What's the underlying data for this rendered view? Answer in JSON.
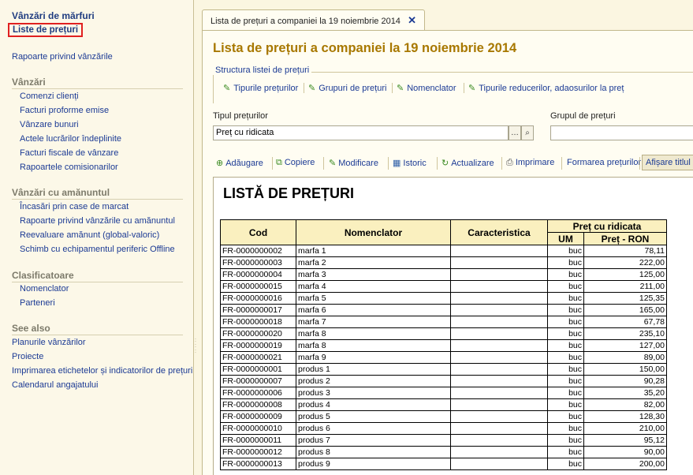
{
  "sidebar": {
    "header_top": "Vânzări de mărfuri",
    "active_item": "Liste de prețuri",
    "sales_reports": "Rapoarte privind vânzările",
    "sections": [
      {
        "title": "Vânzări",
        "items": [
          "Comenzi clienți",
          "Facturi proforme emise",
          "Vânzare bunuri",
          "Actele lucrărilor îndeplinite",
          "Facturi fiscale de vânzare",
          "Rapoartele comisionarilor"
        ]
      },
      {
        "title": "Vânzări cu amănuntul",
        "items": [
          "Încasări prin case de marcat",
          "Rapoarte privind vânzările cu amănuntul",
          "Reevaluare amănunt (global-valoric)",
          "Schimb cu echipamentul periferic Offline"
        ]
      },
      {
        "title": "Clasificatoare",
        "items": [
          "Nomenclator",
          "Parteneri"
        ]
      }
    ],
    "see_also": {
      "title": "See also",
      "items": [
        "Planurile vânzărilor",
        "Proiecte",
        "Imprimarea etichetelor și indicatorilor de prețuri",
        "Calendarul angajatului"
      ]
    }
  },
  "tab": {
    "label": "Lista de prețuri a companiei la 19 noiembrie 2014",
    "close": "✕"
  },
  "main": {
    "title": "Lista de prețuri a companiei la 19 noiembrie 2014",
    "structure": {
      "legend": "Structura listei de prețuri",
      "links": [
        "Tipurile prețurilor",
        "Grupuri de prețuri",
        "Nomenclator",
        "Tipurile reducerilor, adaosurilor la preț"
      ]
    },
    "fields": {
      "price_type_label": "Tipul prețurilor",
      "price_type_value": "Preț cu ridicata",
      "price_group_label": "Grupul de prețuri"
    },
    "toolbar": {
      "add": "Adăugare",
      "copy": "Copiere",
      "modify": "Modificare",
      "history": "Istoric",
      "refresh": "Actualizare",
      "print": "Imprimare",
      "formation": "Formarea prețurilor",
      "show_title": "Afișare titlul"
    }
  },
  "report": {
    "title": "LISTĂ DE PREȚURI",
    "headers": {
      "code": "Cod",
      "nomenclature": "Nomenclator",
      "characteristic": "Caracteristica",
      "group": "Preț cu ridicata",
      "um": "UM",
      "price": "Preț - RON"
    },
    "rows": [
      {
        "code": "FR-0000000002",
        "name": "marfa 1",
        "um": "buc",
        "price": "78,11"
      },
      {
        "code": "FR-0000000003",
        "name": "marfa 2",
        "um": "buc",
        "price": "222,00"
      },
      {
        "code": "FR-0000000004",
        "name": "marfa 3",
        "um": "buc",
        "price": "125,00"
      },
      {
        "code": "FR-0000000015",
        "name": "marfa 4",
        "um": "buc",
        "price": "211,00"
      },
      {
        "code": "FR-0000000016",
        "name": "marfa 5",
        "um": "buc",
        "price": "125,35"
      },
      {
        "code": "FR-0000000017",
        "name": "marfa 6",
        "um": "buc",
        "price": "165,00"
      },
      {
        "code": "FR-0000000018",
        "name": "marfa 7",
        "um": "buc",
        "price": "67,78"
      },
      {
        "code": "FR-0000000020",
        "name": "marfa 8",
        "um": "buc",
        "price": "235,10"
      },
      {
        "code": "FR-0000000019",
        "name": "marfa 8",
        "um": "buc",
        "price": "127,00"
      },
      {
        "code": "FR-0000000021",
        "name": "marfa 9",
        "um": "buc",
        "price": "89,00"
      },
      {
        "code": "FR-0000000001",
        "name": "produs 1",
        "um": "buc",
        "price": "150,00"
      },
      {
        "code": "FR-0000000007",
        "name": "produs 2",
        "um": "buc",
        "price": "90,28"
      },
      {
        "code": "FR-0000000006",
        "name": "produs 3",
        "um": "buc",
        "price": "35,20"
      },
      {
        "code": "FR-0000000008",
        "name": "produs 4",
        "um": "buc",
        "price": "82,00"
      },
      {
        "code": "FR-0000000009",
        "name": "produs 5",
        "um": "buc",
        "price": "128,30"
      },
      {
        "code": "FR-0000000010",
        "name": "produs 6",
        "um": "buc",
        "price": "210,00"
      },
      {
        "code": "FR-0000000011",
        "name": "produs 7",
        "um": "buc",
        "price": "95,12"
      },
      {
        "code": "FR-0000000012",
        "name": "produs 8",
        "um": "buc",
        "price": "90,00"
      },
      {
        "code": "FR-0000000013",
        "name": "produs 9",
        "um": "buc",
        "price": "200,00"
      }
    ]
  }
}
